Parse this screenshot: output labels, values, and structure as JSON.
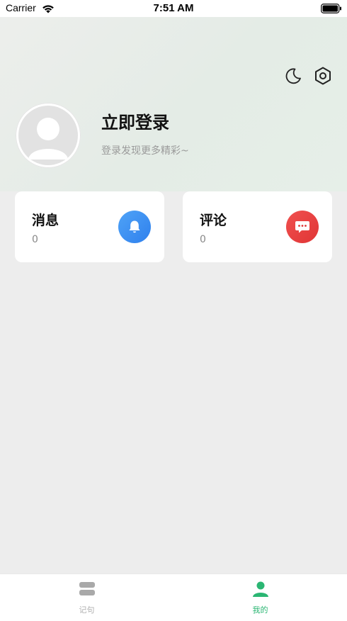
{
  "status_bar": {
    "carrier": "Carrier",
    "time": "7:51 AM"
  },
  "header": {
    "icons": [
      "moon-icon",
      "settings-icon"
    ]
  },
  "profile": {
    "login_title": "立即登录",
    "login_subtitle": "登录发现更多精彩~"
  },
  "cards": {
    "messages": {
      "title": "消息",
      "count": "0",
      "icon": "bell-icon",
      "color": "#2f80ed"
    },
    "comments": {
      "title": "评论",
      "count": "0",
      "icon": "chat-bubble-icon",
      "color": "#e03535"
    }
  },
  "tab_bar": {
    "items": [
      {
        "label": "记句",
        "icon": "stack-icon",
        "active": false
      },
      {
        "label": "我的",
        "icon": "person-icon",
        "active": true
      }
    ],
    "active_color": "#2bb673",
    "inactive_color": "#b0b0b0"
  }
}
